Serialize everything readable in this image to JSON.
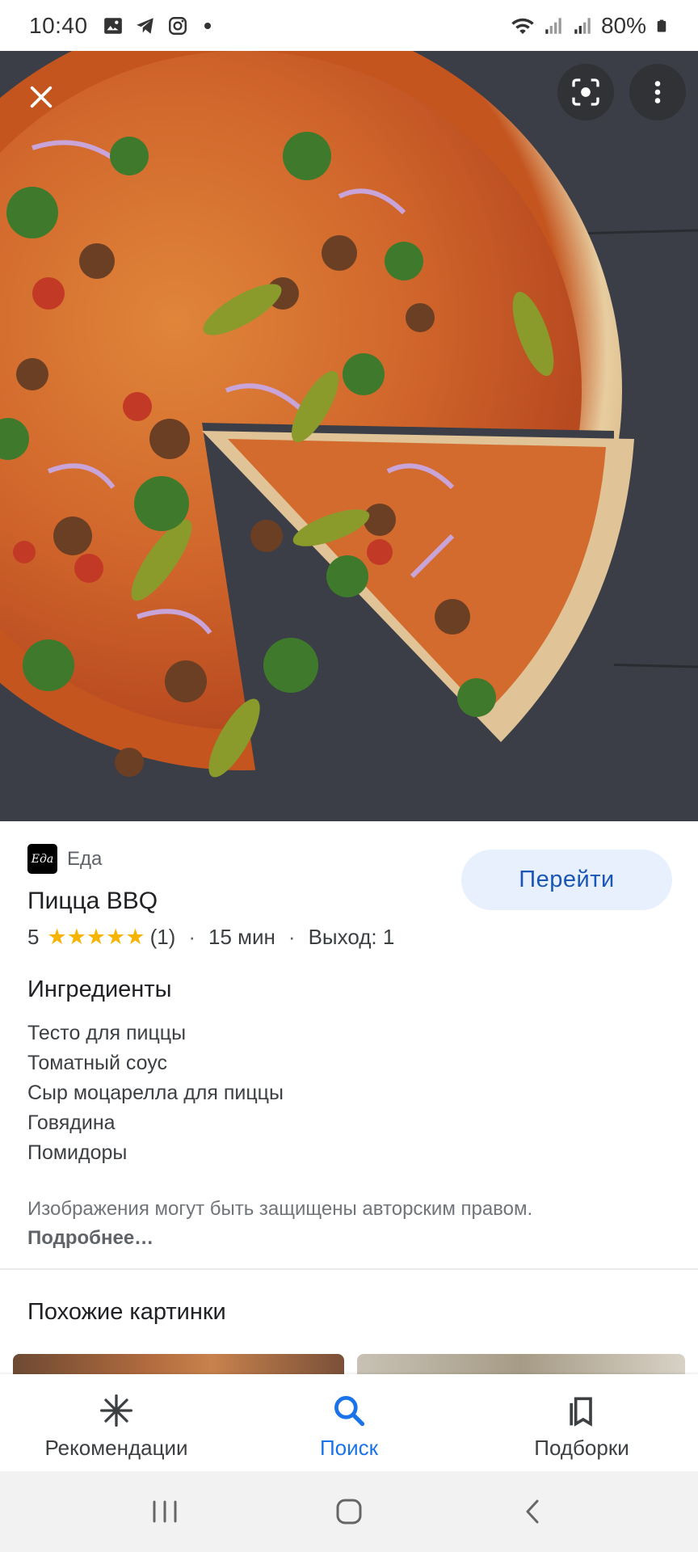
{
  "status_bar": {
    "time": "10:40",
    "battery": "80%"
  },
  "hero": {
    "icons": [
      "close-icon",
      "lens-icon",
      "more-vert-icon"
    ]
  },
  "source": {
    "logo_text": "Еда",
    "name": "Еда"
  },
  "action": {
    "go_label": "Перейти"
  },
  "recipe": {
    "title": "Пицца BBQ",
    "rating": "5",
    "stars": 5,
    "reviews": "(1)",
    "time": "15 мин",
    "yield": "Выход: 1",
    "ingredients_heading": "Ингредиенты",
    "ingredients": [
      "Тесто для пиццы",
      "Томатный соус",
      "Сыр моцарелла для пиццы",
      "Говядина",
      "Помидоры"
    ]
  },
  "notice": {
    "text": "Изображения могут быть защищены авторским правом. ",
    "link": "Подробнее…"
  },
  "similar": {
    "heading": "Похожие картинки"
  },
  "bottom_nav": {
    "items": [
      {
        "label": "Рекомендации",
        "icon": "asterisk-icon"
      },
      {
        "label": "Поиск",
        "icon": "search-icon"
      },
      {
        "label": "Подборки",
        "icon": "collections-icon"
      }
    ],
    "active": "Поиск"
  },
  "colors": {
    "accent": "#1a73e8",
    "button_bg": "#e8f0fe",
    "star": "#f6b400"
  }
}
